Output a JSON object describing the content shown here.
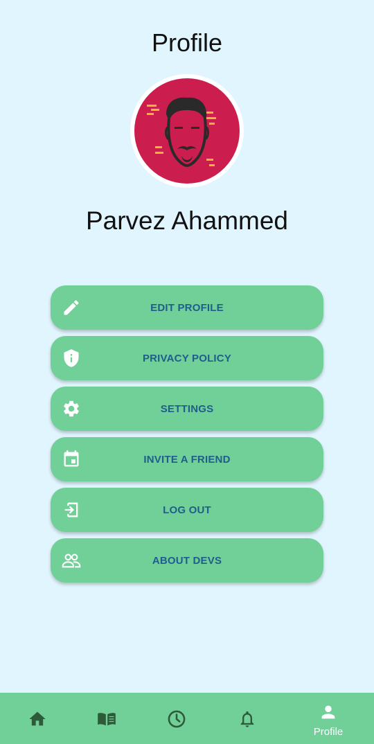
{
  "header": {
    "title": "Profile"
  },
  "profile": {
    "name": "Parvez Ahammed",
    "avatar_bg": "#cc1d4f"
  },
  "menu": {
    "items": [
      {
        "label": "EDIT PROFILE",
        "icon": "pencil-icon"
      },
      {
        "label": "PRIVACY POLICY",
        "icon": "shield-info-icon"
      },
      {
        "label": "SETTINGS",
        "icon": "gear-icon"
      },
      {
        "label": "INVITE A FRIEND",
        "icon": "calendar-event-icon"
      },
      {
        "label": "LOG OUT",
        "icon": "logout-icon"
      },
      {
        "label": "ABOUT DEVS",
        "icon": "people-icon"
      }
    ]
  },
  "bottom_nav": {
    "items": [
      {
        "icon": "home-icon",
        "label": ""
      },
      {
        "icon": "book-icon",
        "label": ""
      },
      {
        "icon": "clock-icon",
        "label": ""
      },
      {
        "icon": "bell-icon",
        "label": ""
      },
      {
        "icon": "person-icon",
        "label": "Profile",
        "active": true
      }
    ]
  },
  "colors": {
    "background": "#e1f5fe",
    "button": "#71d097",
    "button_text": "#1f5d8c",
    "nav_icon": "#2e5a3a",
    "nav_active": "#ffffff"
  }
}
